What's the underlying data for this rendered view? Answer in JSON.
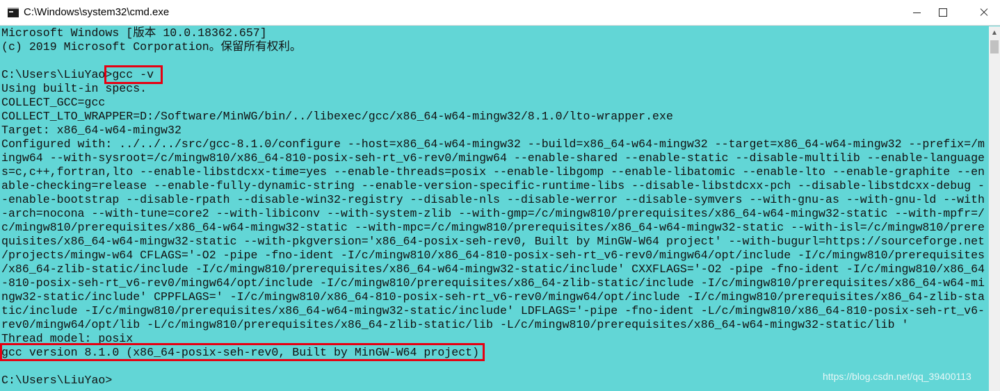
{
  "window": {
    "title": "C:\\Windows\\system32\\cmd.exe",
    "icon": "cmd-icon",
    "controls": [
      "minimize",
      "maximize",
      "close"
    ]
  },
  "console": {
    "background_color": "#62d6d6",
    "text_color": "#111111",
    "lines": [
      "Microsoft Windows [版本 10.0.18362.657]",
      "(c) 2019 Microsoft Corporation。保留所有权利。",
      "",
      "C:\\Users\\LiuYao>gcc -v",
      "Using built-in specs.",
      "COLLECT_GCC=gcc",
      "COLLECT_LTO_WRAPPER=D:/Software/MinWG/bin/../libexec/gcc/x86_64-w64-mingw32/8.1.0/lto-wrapper.exe",
      "Target: x86_64-w64-mingw32",
      "Configured with: ../../../src/gcc-8.1.0/configure --host=x86_64-w64-mingw32 --build=x86_64-w64-mingw32 --target=x86_64-w64-mingw32 --prefix=/m",
      "ingw64 --with-sysroot=/c/mingw810/x86_64-810-posix-seh-rt_v6-rev0/mingw64 --enable-shared --enable-static --disable-multilib --enable-language",
      "s=c,c++,fortran,lto --enable-libstdcxx-time=yes --enable-threads=posix --enable-libgomp --enable-libatomic --enable-lto --enable-graphite --en",
      "able-checking=release --enable-fully-dynamic-string --enable-version-specific-runtime-libs --disable-libstdcxx-pch --disable-libstdcxx-debug -",
      "-enable-bootstrap --disable-rpath --disable-win32-registry --disable-nls --disable-werror --disable-symvers --with-gnu-as --with-gnu-ld --with",
      "-arch=nocona --with-tune=core2 --with-libiconv --with-system-zlib --with-gmp=/c/mingw810/prerequisites/x86_64-w64-mingw32-static --with-mpfr=/",
      "c/mingw810/prerequisites/x86_64-w64-mingw32-static --with-mpc=/c/mingw810/prerequisites/x86_64-w64-mingw32-static --with-isl=/c/mingw810/prere",
      "quisites/x86_64-w64-mingw32-static --with-pkgversion='x86_64-posix-seh-rev0, Built by MinGW-W64 project' --with-bugurl=https://sourceforge.net",
      "/projects/mingw-w64 CFLAGS='-O2 -pipe -fno-ident -I/c/mingw810/x86_64-810-posix-seh-rt_v6-rev0/mingw64/opt/include -I/c/mingw810/prerequisites",
      "/x86_64-zlib-static/include -I/c/mingw810/prerequisites/x86_64-w64-mingw32-static/include' CXXFLAGS='-O2 -pipe -fno-ident -I/c/mingw810/x86_64",
      "-810-posix-seh-rt_v6-rev0/mingw64/opt/include -I/c/mingw810/prerequisites/x86_64-zlib-static/include -I/c/mingw810/prerequisites/x86_64-w64-mi",
      "ngw32-static/include' CPPFLAGS=' -I/c/mingw810/x86_64-810-posix-seh-rt_v6-rev0/mingw64/opt/include -I/c/mingw810/prerequisites/x86_64-zlib-sta",
      "tic/include -I/c/mingw810/prerequisites/x86_64-w64-mingw32-static/include' LDFLAGS='-pipe -fno-ident -L/c/mingw810/x86_64-810-posix-seh-rt_v6-",
      "rev0/mingw64/opt/lib -L/c/mingw810/prerequisites/x86_64-zlib-static/lib -L/c/mingw810/prerequisites/x86_64-w64-mingw32-static/lib '",
      "Thread model: posix",
      "gcc version 8.1.0 (x86_64-posix-seh-rev0, Built by MinGW-W64 project)",
      "",
      "C:\\Users\\LiuYao>"
    ]
  },
  "annotations": {
    "highlight_color": "#e60012",
    "command_highlight": "gcc -v",
    "version_highlight": "gcc version 8.1.0 (x86_64-posix-seh-rev0, Built by MinGW-W64 project)"
  },
  "watermark": "https://blog.csdn.net/qq_39400113"
}
